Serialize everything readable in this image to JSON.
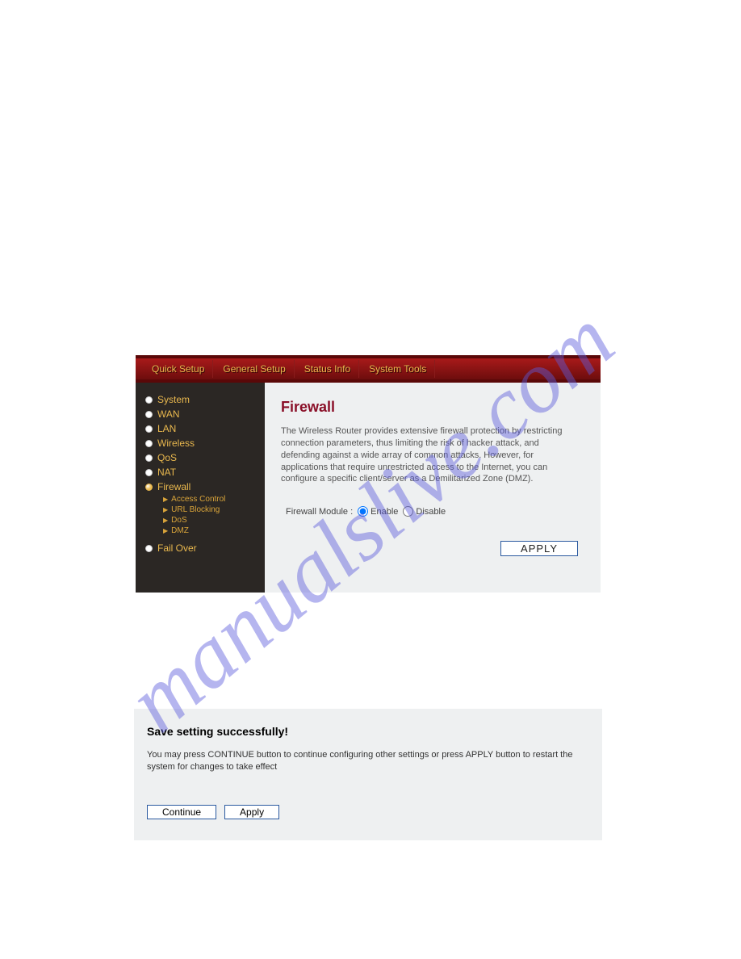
{
  "watermark_text": "manualslive.com",
  "topnav": [
    "Quick Setup",
    "General Setup",
    "Status Info",
    "System Tools"
  ],
  "sidenav": {
    "items": [
      {
        "label": "System",
        "active": false
      },
      {
        "label": "WAN",
        "active": false
      },
      {
        "label": "LAN",
        "active": false
      },
      {
        "label": "Wireless",
        "active": false
      },
      {
        "label": "QoS",
        "active": false
      },
      {
        "label": "NAT",
        "active": false
      },
      {
        "label": "Firewall",
        "active": true
      },
      {
        "label": "Fail Over",
        "active": false
      }
    ],
    "firewall_sub": [
      "Access Control",
      "URL Blocking",
      "DoS",
      "DMZ"
    ]
  },
  "content": {
    "title": "Firewall",
    "description": "The Wireless Router provides extensive firewall protection by restricting connection parameters, thus limiting the risk of hacker attack, and defending against a wide array of common attacks. However, for applications that require unrestricted access to the Internet, you can configure a specific client/server as a Demilitarized Zone (DMZ).",
    "module_label": "Firewall Module :",
    "enable_label": "Enable",
    "disable_label": "Disable",
    "module_selected": "enable",
    "apply_button": "APPLY"
  },
  "save_panel": {
    "title": "Save setting successfully!",
    "message": "You may press CONTINUE button to continue configuring other settings or press APPLY button to restart the system for changes to take effect",
    "continue_button": "Continue",
    "apply_button": "Apply"
  }
}
